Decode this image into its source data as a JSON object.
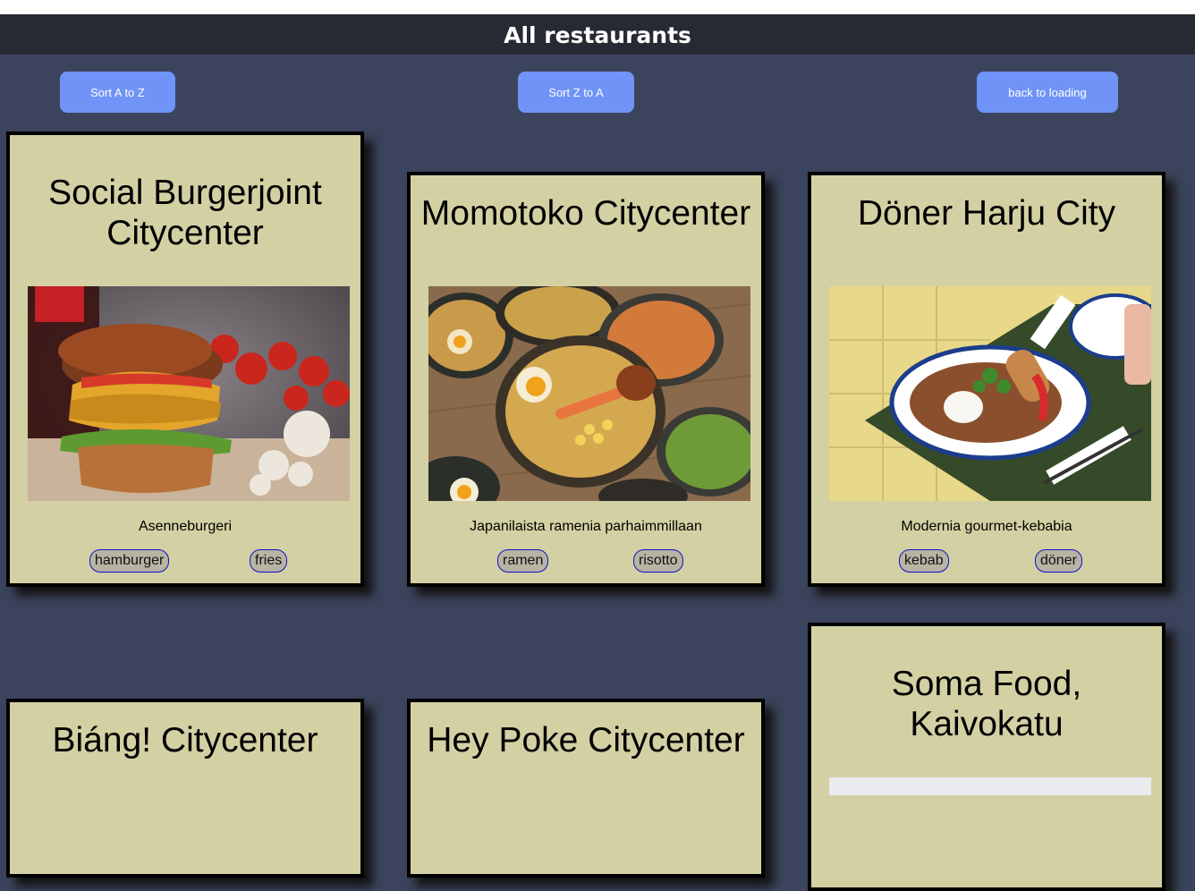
{
  "page": {
    "title": "All restaurants"
  },
  "toolbar": {
    "sort_az": "Sort A to Z",
    "sort_za": "Sort Z to A",
    "back": "back to loading"
  },
  "restaurants": [
    {
      "name": "Social Burgerjoint Citycenter",
      "description": "Asenneburgeri",
      "tags": [
        "hamburger",
        "fries"
      ]
    },
    {
      "name": "Momotoko Citycenter",
      "description": "Japanilaista ramenia parhaimmillaan",
      "tags": [
        "ramen",
        "risotto"
      ]
    },
    {
      "name": "Döner Harju City",
      "description": "Modernia gourmet-kebabia",
      "tags": [
        "kebab",
        "döner"
      ]
    },
    {
      "name": "Biáng! Citycenter"
    },
    {
      "name": "Hey Poke Citycenter"
    },
    {
      "name": "Soma Food, Kaivokatu"
    }
  ],
  "colors": {
    "background": "#3b445c",
    "header": "#272a32",
    "button": "#6f93f7",
    "card": "#d3d1a4"
  }
}
